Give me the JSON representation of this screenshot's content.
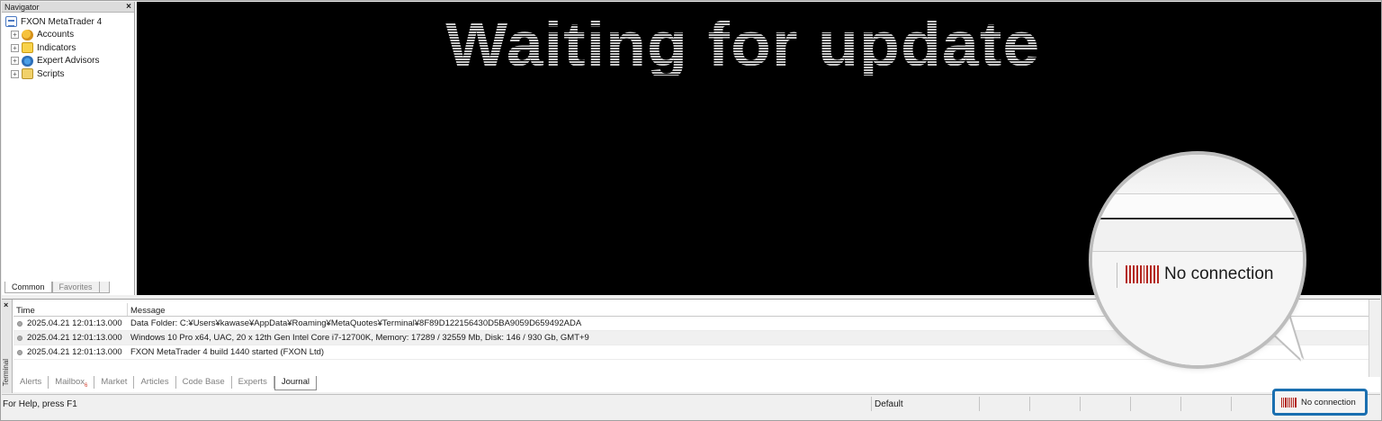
{
  "navigator": {
    "title": "Navigator",
    "close": "×",
    "root": "FXON MetaTrader 4",
    "items": [
      {
        "label": "Accounts"
      },
      {
        "label": "Indicators"
      },
      {
        "label": "Expert Advisors"
      },
      {
        "label": "Scripts"
      }
    ],
    "tabs": [
      {
        "label": "Common",
        "active": true
      },
      {
        "label": "Favorites",
        "active": false
      }
    ]
  },
  "chart": {
    "message": "Waiting for update"
  },
  "terminal": {
    "close": "×",
    "label": "Terminal",
    "columns": {
      "time": "Time",
      "message": "Message"
    },
    "rows": [
      {
        "time": "2025.04.21 12:01:13.000",
        "message": "Data Folder: C:¥Users¥kawase¥AppData¥Roaming¥MetaQuotes¥Terminal¥8F89D122156430D5BA9059D659492ADA"
      },
      {
        "time": "2025.04.21 12:01:13.000",
        "message": "Windows 10 Pro x64, UAC, 20 x 12th Gen Intel Core i7-12700K, Memory: 17289 / 32559 Mb, Disk: 146 / 930 Gb, GMT+9"
      },
      {
        "time": "2025.04.21 12:01:13.000",
        "message": "FXON MetaTrader 4 build 1440 started (FXON Ltd)"
      }
    ],
    "tabs": [
      {
        "label": "Alerts"
      },
      {
        "label": "Mailbox",
        "badge": "6"
      },
      {
        "label": "Market"
      },
      {
        "label": "Articles"
      },
      {
        "label": "Code Base"
      },
      {
        "label": "Experts"
      },
      {
        "label": "Journal",
        "active": true
      }
    ]
  },
  "statusbar": {
    "help": "For Help, press F1",
    "profile": "Default",
    "connection": "No connection",
    "connection_color": "#b3261e",
    "highlight_color": "#1a6fb0"
  }
}
